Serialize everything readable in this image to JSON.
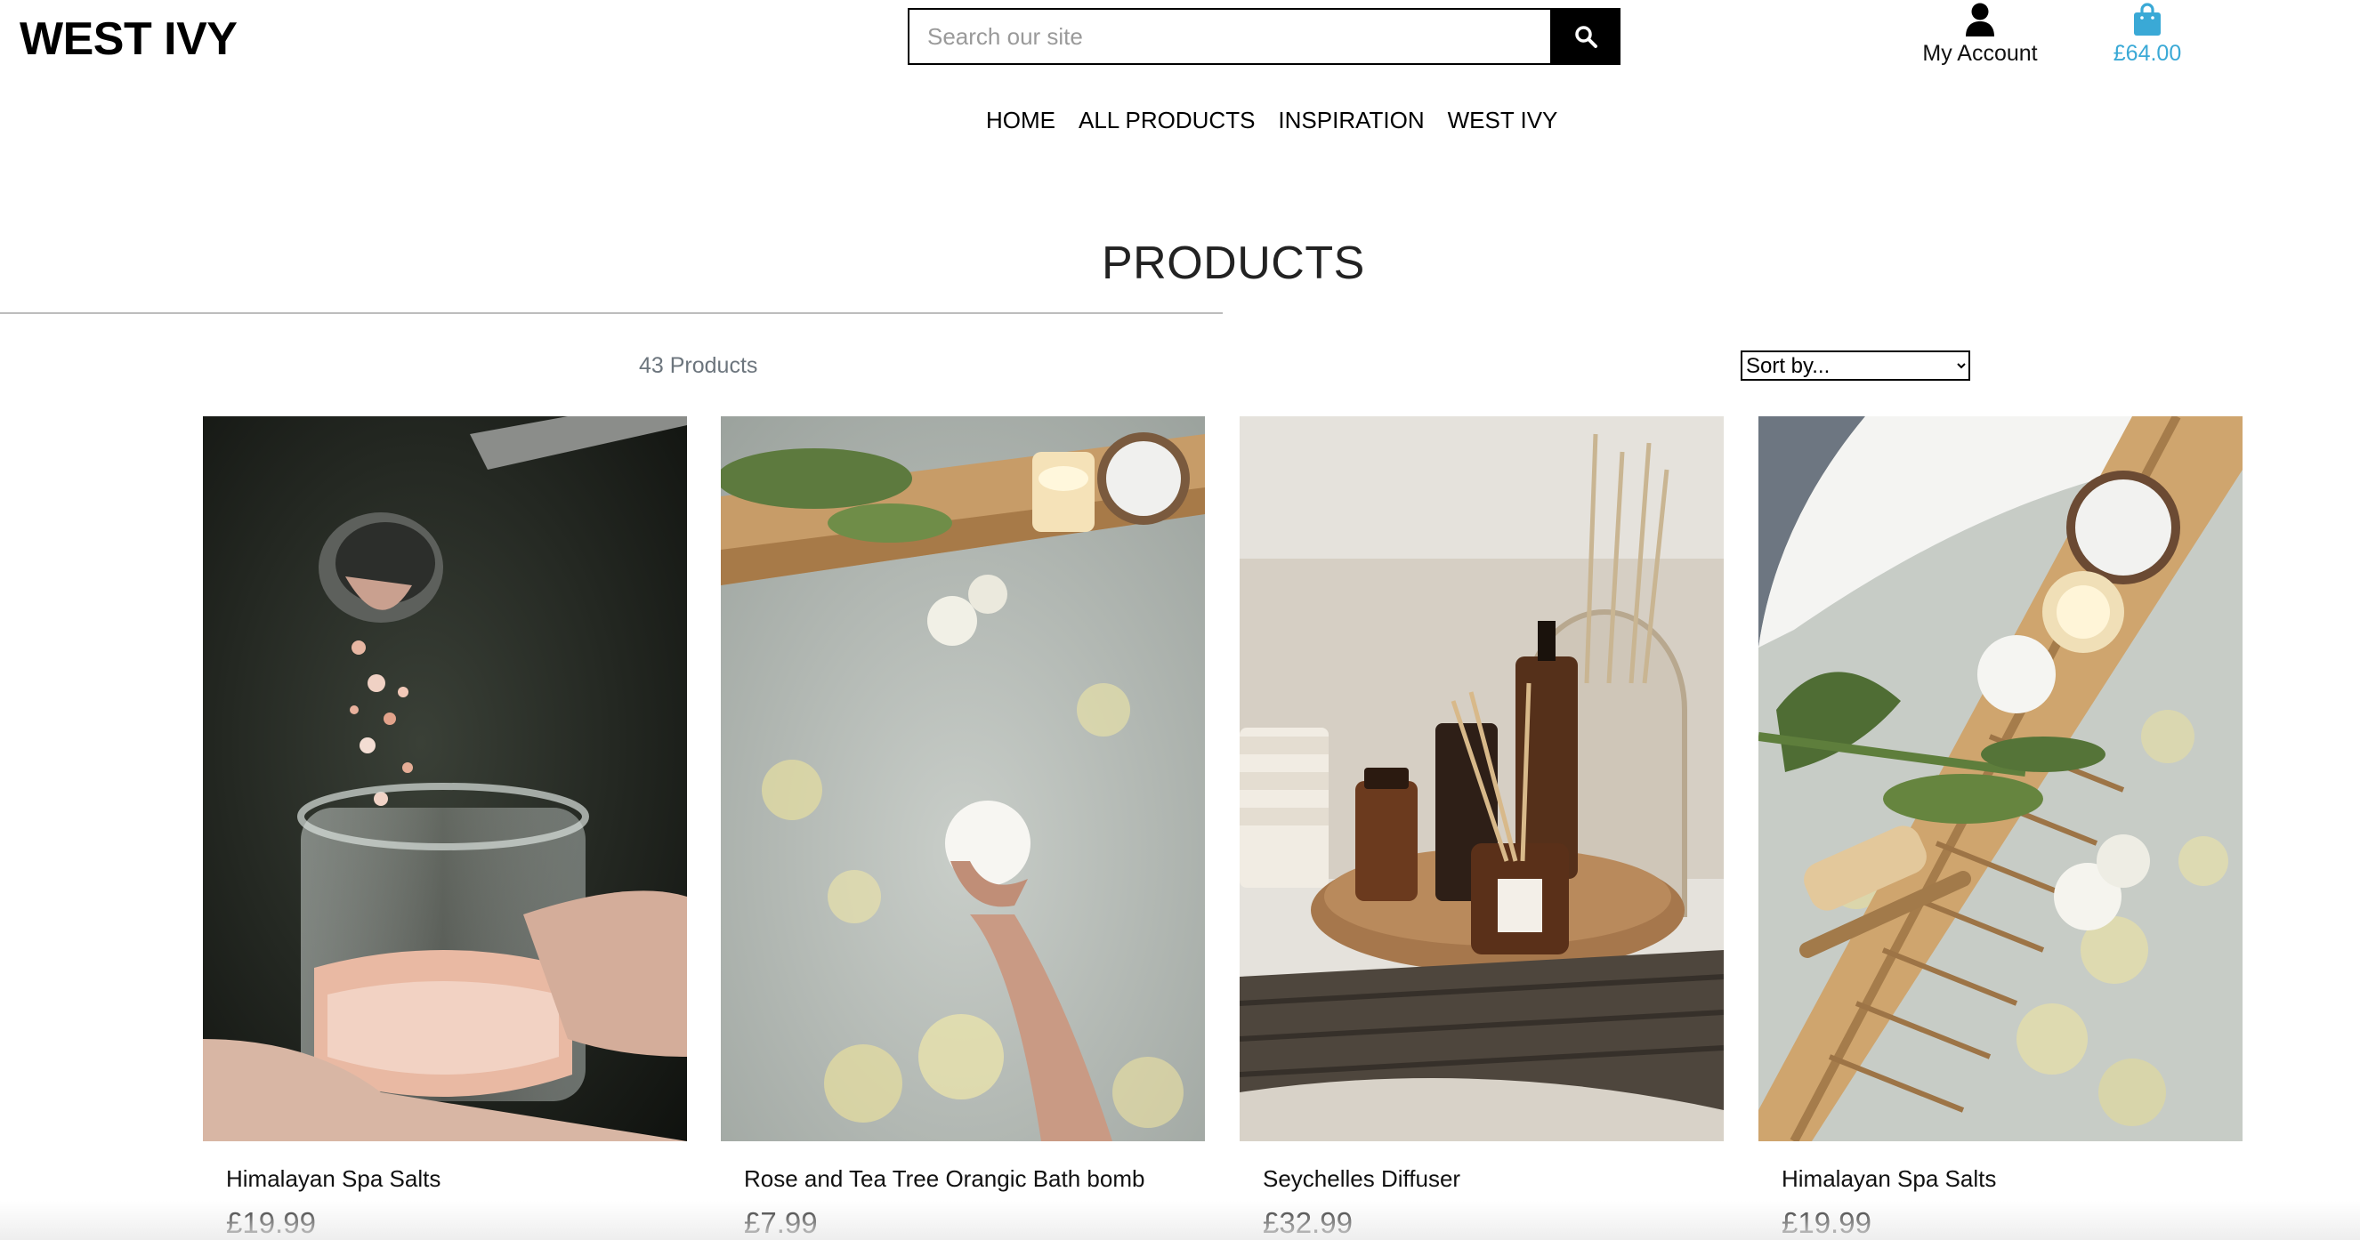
{
  "header": {
    "logo": "WEST IVY",
    "search": {
      "placeholder": "Search our site",
      "icon": "search-icon"
    },
    "account": {
      "label": "My Account",
      "icon": "user-icon"
    },
    "bag": {
      "total": "£64.00",
      "icon": "shopping-bag-icon",
      "color": "#3aa9d6"
    }
  },
  "nav": {
    "items": [
      {
        "label": "HOME"
      },
      {
        "label": "ALL PRODUCTS"
      },
      {
        "label": "INSPIRATION"
      },
      {
        "label": "WEST IVY"
      }
    ]
  },
  "main": {
    "title": "PRODUCTS",
    "count": "43 Products",
    "sort": {
      "selected": "Sort by..."
    },
    "products": [
      {
        "name": "Himalayan Spa Salts",
        "price": "£19.99"
      },
      {
        "name": "Rose and Tea Tree Orangic Bath bomb",
        "price": "£7.99"
      },
      {
        "name": "Seychelles Diffuser",
        "price": "£32.99"
      },
      {
        "name": "Himalayan Spa Salts",
        "price": "£19.99"
      }
    ]
  }
}
